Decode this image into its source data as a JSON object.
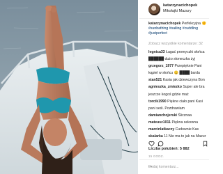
{
  "post": {
    "username": "katarzynacichopek",
    "location": "Mikołajki Mazury",
    "caption_user": "katarzynacichopek",
    "caption_text": "Perfekcyjna",
    "caption_cont": "🌞 ",
    "caption_tags_1": "#sunbathing #sailing #cuddling",
    "caption_tags_2": "#justperfect",
    "load_more": "Zobacz wszystkie komentarze: 32",
    "likes": "Liczba polubień: 5 882",
    "date": "15 GODZ.",
    "add_comment_placeholder": "Dodaj komentarz..."
  },
  "comments": [
    {
      "user": "legnica33",
      "text": "Łagać promyczki słońca"
    },
    {
      "user": "",
      "text": "██████ dużo słoneczka żyj"
    },
    {
      "user": "grzegorz_1977",
      "text": "Przepięknie Pani"
    },
    {
      "user": "",
      "text": "kąpiel w słońcu 😊 ████ barda"
    },
    {
      "user": "stan521",
      "text": "Kasia jak dziewczyna Bon"
    },
    {
      "user": "agnieszka_zmiezko",
      "text": "Super ale bra"
    },
    {
      "user": "",
      "text": "jeszcze kogoś gdzie maż"
    },
    {
      "user": "torcik1990",
      "text": "Piękne ciało pani Kasi"
    },
    {
      "user": "",
      "text": "pani seśi. Pozdrawiam"
    },
    {
      "user": "damianchojerski",
      "text": "Ślicznaa"
    },
    {
      "user": "mateusz1011",
      "text": "Piękna sekswna"
    },
    {
      "user": "marcinlatkaczy",
      "text": "Cudownie Kas"
    },
    {
      "user": "skalarka",
      "text": "11 Nie ma to jak na Mazur"
    }
  ]
}
